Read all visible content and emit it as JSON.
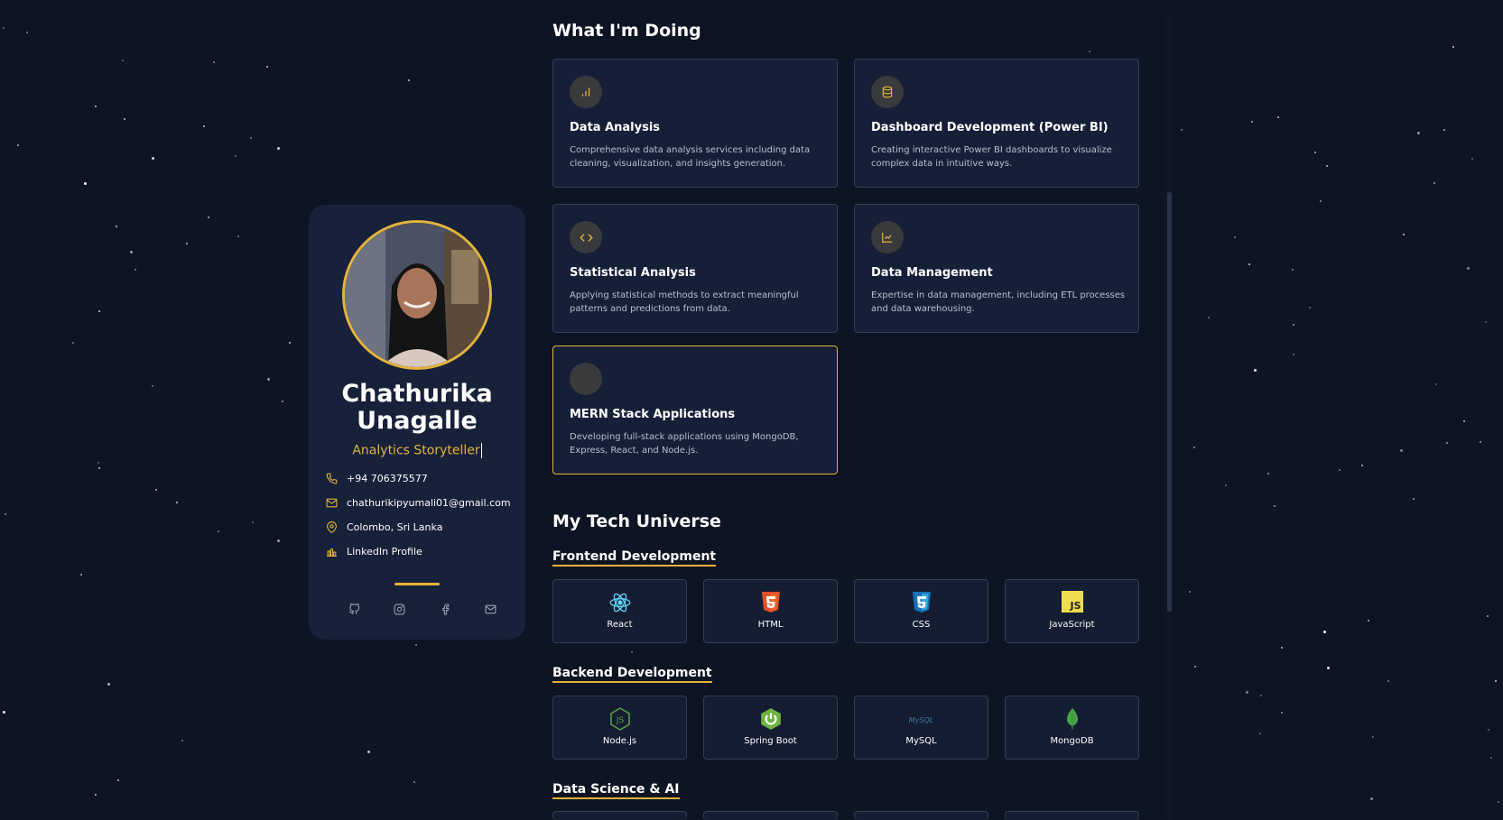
{
  "profile": {
    "name_line1": "Chathurika",
    "name_line2": "Unagalle",
    "role": "Analytics Storyteller",
    "contacts": [
      {
        "icon": "phone-icon",
        "text": "+94 706375577"
      },
      {
        "icon": "mail-icon",
        "text": "chathurikipyumali01@gmail.com"
      },
      {
        "icon": "location-pin-icon",
        "text": "Colombo, Sri Lanka"
      },
      {
        "icon": "linkedin-icon",
        "text": "LinkedIn Profile"
      }
    ],
    "socials": [
      "github-icon",
      "instagram-icon",
      "facebook-icon",
      "email-icon"
    ]
  },
  "services": {
    "heading": "What I'm Doing",
    "items": [
      {
        "icon": "bar-chart-icon",
        "title": "Data Analysis",
        "desc": "Comprehensive data analysis services including data cleaning, visualization, and insights generation."
      },
      {
        "icon": "database-icon",
        "title": "Dashboard Development (Power BI)",
        "desc": "Creating interactive Power BI dashboards to visualize complex data in intuitive ways."
      },
      {
        "icon": "code-icon",
        "title": "Statistical Analysis",
        "desc": "Applying statistical methods to extract meaningful patterns and predictions from data."
      },
      {
        "icon": "line-chart-icon",
        "title": "Data Management",
        "desc": "Expertise in data management, including ETL processes and data warehousing."
      },
      {
        "icon": "",
        "title": "MERN Stack Applications",
        "desc": "Developing full-stack applications using MongoDB, Express, React, and Node.js."
      }
    ]
  },
  "tech": {
    "heading": "My Tech Universe",
    "groups": [
      {
        "title": "Frontend Development",
        "items": [
          {
            "icon": "react-icon",
            "label": "React"
          },
          {
            "icon": "html5-icon",
            "label": "HTML"
          },
          {
            "icon": "css3-icon",
            "label": "CSS"
          },
          {
            "icon": "javascript-icon",
            "label": "JavaScript"
          }
        ]
      },
      {
        "title": "Backend Development",
        "items": [
          {
            "icon": "nodejs-icon",
            "label": "Node.js"
          },
          {
            "icon": "spring-boot-icon",
            "label": "Spring Boot"
          },
          {
            "icon": "mysql-icon",
            "label": "MySQL"
          },
          {
            "icon": "mongodb-icon",
            "label": "MongoDB"
          }
        ]
      },
      {
        "title": "Data Science & AI",
        "items": []
      }
    ],
    "mysql_logo_text": "MySQL",
    "js_logo_text": "JS"
  },
  "colors": {
    "background": "#0d1423",
    "card": "#18213a",
    "accent": "#e4b43b"
  }
}
